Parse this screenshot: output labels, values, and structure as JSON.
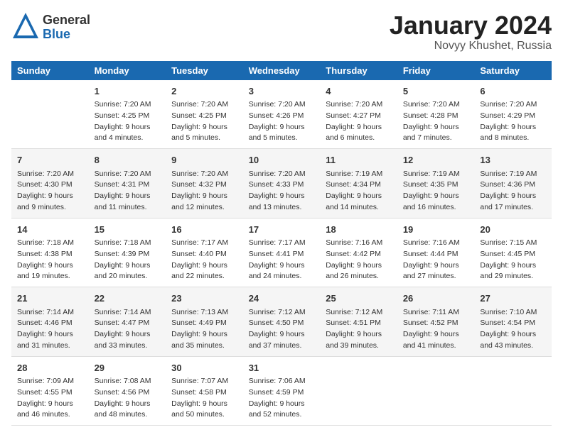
{
  "header": {
    "logo_general": "General",
    "logo_blue": "Blue",
    "month": "January 2024",
    "location": "Novyy Khushet, Russia"
  },
  "days_of_week": [
    "Sunday",
    "Monday",
    "Tuesday",
    "Wednesday",
    "Thursday",
    "Friday",
    "Saturday"
  ],
  "weeks": [
    [
      {
        "day": "",
        "sunrise": "",
        "sunset": "",
        "daylight": ""
      },
      {
        "day": "1",
        "sunrise": "Sunrise: 7:20 AM",
        "sunset": "Sunset: 4:25 PM",
        "daylight": "Daylight: 9 hours and 4 minutes."
      },
      {
        "day": "2",
        "sunrise": "Sunrise: 7:20 AM",
        "sunset": "Sunset: 4:25 PM",
        "daylight": "Daylight: 9 hours and 5 minutes."
      },
      {
        "day": "3",
        "sunrise": "Sunrise: 7:20 AM",
        "sunset": "Sunset: 4:26 PM",
        "daylight": "Daylight: 9 hours and 5 minutes."
      },
      {
        "day": "4",
        "sunrise": "Sunrise: 7:20 AM",
        "sunset": "Sunset: 4:27 PM",
        "daylight": "Daylight: 9 hours and 6 minutes."
      },
      {
        "day": "5",
        "sunrise": "Sunrise: 7:20 AM",
        "sunset": "Sunset: 4:28 PM",
        "daylight": "Daylight: 9 hours and 7 minutes."
      },
      {
        "day": "6",
        "sunrise": "Sunrise: 7:20 AM",
        "sunset": "Sunset: 4:29 PM",
        "daylight": "Daylight: 9 hours and 8 minutes."
      }
    ],
    [
      {
        "day": "7",
        "sunrise": "Sunrise: 7:20 AM",
        "sunset": "Sunset: 4:30 PM",
        "daylight": "Daylight: 9 hours and 9 minutes."
      },
      {
        "day": "8",
        "sunrise": "Sunrise: 7:20 AM",
        "sunset": "Sunset: 4:31 PM",
        "daylight": "Daylight: 9 hours and 11 minutes."
      },
      {
        "day": "9",
        "sunrise": "Sunrise: 7:20 AM",
        "sunset": "Sunset: 4:32 PM",
        "daylight": "Daylight: 9 hours and 12 minutes."
      },
      {
        "day": "10",
        "sunrise": "Sunrise: 7:20 AM",
        "sunset": "Sunset: 4:33 PM",
        "daylight": "Daylight: 9 hours and 13 minutes."
      },
      {
        "day": "11",
        "sunrise": "Sunrise: 7:19 AM",
        "sunset": "Sunset: 4:34 PM",
        "daylight": "Daylight: 9 hours and 14 minutes."
      },
      {
        "day": "12",
        "sunrise": "Sunrise: 7:19 AM",
        "sunset": "Sunset: 4:35 PM",
        "daylight": "Daylight: 9 hours and 16 minutes."
      },
      {
        "day": "13",
        "sunrise": "Sunrise: 7:19 AM",
        "sunset": "Sunset: 4:36 PM",
        "daylight": "Daylight: 9 hours and 17 minutes."
      }
    ],
    [
      {
        "day": "14",
        "sunrise": "Sunrise: 7:18 AM",
        "sunset": "Sunset: 4:38 PM",
        "daylight": "Daylight: 9 hours and 19 minutes."
      },
      {
        "day": "15",
        "sunrise": "Sunrise: 7:18 AM",
        "sunset": "Sunset: 4:39 PM",
        "daylight": "Daylight: 9 hours and 20 minutes."
      },
      {
        "day": "16",
        "sunrise": "Sunrise: 7:17 AM",
        "sunset": "Sunset: 4:40 PM",
        "daylight": "Daylight: 9 hours and 22 minutes."
      },
      {
        "day": "17",
        "sunrise": "Sunrise: 7:17 AM",
        "sunset": "Sunset: 4:41 PM",
        "daylight": "Daylight: 9 hours and 24 minutes."
      },
      {
        "day": "18",
        "sunrise": "Sunrise: 7:16 AM",
        "sunset": "Sunset: 4:42 PM",
        "daylight": "Daylight: 9 hours and 26 minutes."
      },
      {
        "day": "19",
        "sunrise": "Sunrise: 7:16 AM",
        "sunset": "Sunset: 4:44 PM",
        "daylight": "Daylight: 9 hours and 27 minutes."
      },
      {
        "day": "20",
        "sunrise": "Sunrise: 7:15 AM",
        "sunset": "Sunset: 4:45 PM",
        "daylight": "Daylight: 9 hours and 29 minutes."
      }
    ],
    [
      {
        "day": "21",
        "sunrise": "Sunrise: 7:14 AM",
        "sunset": "Sunset: 4:46 PM",
        "daylight": "Daylight: 9 hours and 31 minutes."
      },
      {
        "day": "22",
        "sunrise": "Sunrise: 7:14 AM",
        "sunset": "Sunset: 4:47 PM",
        "daylight": "Daylight: 9 hours and 33 minutes."
      },
      {
        "day": "23",
        "sunrise": "Sunrise: 7:13 AM",
        "sunset": "Sunset: 4:49 PM",
        "daylight": "Daylight: 9 hours and 35 minutes."
      },
      {
        "day": "24",
        "sunrise": "Sunrise: 7:12 AM",
        "sunset": "Sunset: 4:50 PM",
        "daylight": "Daylight: 9 hours and 37 minutes."
      },
      {
        "day": "25",
        "sunrise": "Sunrise: 7:12 AM",
        "sunset": "Sunset: 4:51 PM",
        "daylight": "Daylight: 9 hours and 39 minutes."
      },
      {
        "day": "26",
        "sunrise": "Sunrise: 7:11 AM",
        "sunset": "Sunset: 4:52 PM",
        "daylight": "Daylight: 9 hours and 41 minutes."
      },
      {
        "day": "27",
        "sunrise": "Sunrise: 7:10 AM",
        "sunset": "Sunset: 4:54 PM",
        "daylight": "Daylight: 9 hours and 43 minutes."
      }
    ],
    [
      {
        "day": "28",
        "sunrise": "Sunrise: 7:09 AM",
        "sunset": "Sunset: 4:55 PM",
        "daylight": "Daylight: 9 hours and 46 minutes."
      },
      {
        "day": "29",
        "sunrise": "Sunrise: 7:08 AM",
        "sunset": "Sunset: 4:56 PM",
        "daylight": "Daylight: 9 hours and 48 minutes."
      },
      {
        "day": "30",
        "sunrise": "Sunrise: 7:07 AM",
        "sunset": "Sunset: 4:58 PM",
        "daylight": "Daylight: 9 hours and 50 minutes."
      },
      {
        "day": "31",
        "sunrise": "Sunrise: 7:06 AM",
        "sunset": "Sunset: 4:59 PM",
        "daylight": "Daylight: 9 hours and 52 minutes."
      },
      {
        "day": "",
        "sunrise": "",
        "sunset": "",
        "daylight": ""
      },
      {
        "day": "",
        "sunrise": "",
        "sunset": "",
        "daylight": ""
      },
      {
        "day": "",
        "sunrise": "",
        "sunset": "",
        "daylight": ""
      }
    ]
  ]
}
